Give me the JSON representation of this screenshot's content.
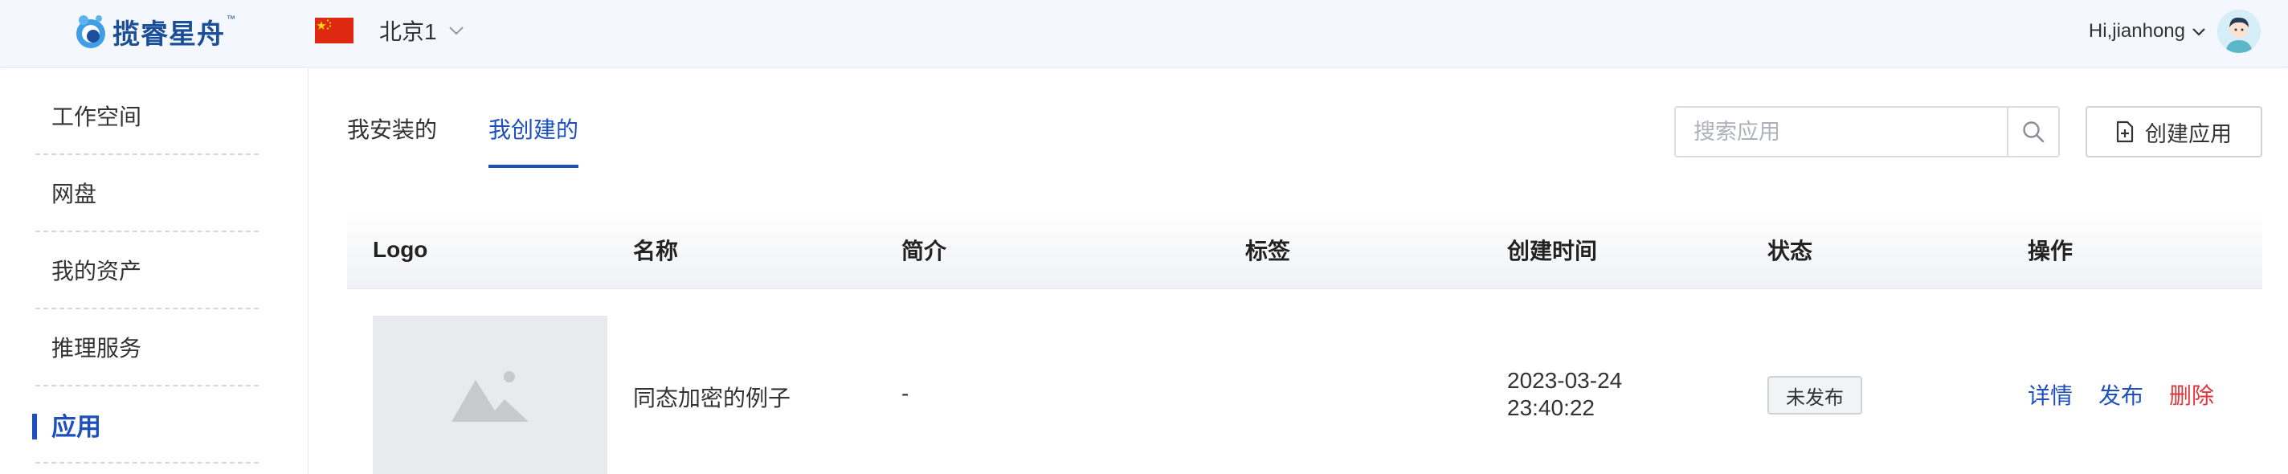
{
  "header": {
    "brand": "揽睿星舟",
    "brand_tm": "™",
    "region": "北京1",
    "user_greeting": "Hi,jianhong"
  },
  "sidebar": {
    "items": [
      {
        "label": "工作空间",
        "active": false
      },
      {
        "label": "网盘",
        "active": false
      },
      {
        "label": "我的资产",
        "active": false
      },
      {
        "label": "推理服务",
        "active": false
      },
      {
        "label": "应用",
        "active": true
      }
    ]
  },
  "tabs": [
    {
      "label": "我安装的",
      "active": false
    },
    {
      "label": "我创建的",
      "active": true
    }
  ],
  "search": {
    "placeholder": "搜索应用",
    "value": ""
  },
  "toolbar": {
    "create_label": "创建应用"
  },
  "table": {
    "columns": [
      "Logo",
      "名称",
      "简介",
      "标签",
      "创建时间",
      "状态",
      "操作"
    ],
    "rows": [
      {
        "name": "同态加密的例子",
        "intro": "-",
        "tags": "",
        "created_date": "2023-03-24",
        "created_time": "23:40:22",
        "status": "未发布",
        "actions": {
          "detail": "详情",
          "publish": "发布",
          "delete": "删除"
        }
      }
    ]
  },
  "colors": {
    "accent": "#1d4fbf",
    "danger": "#e0353b",
    "header_bg": "#f4f7fd"
  }
}
